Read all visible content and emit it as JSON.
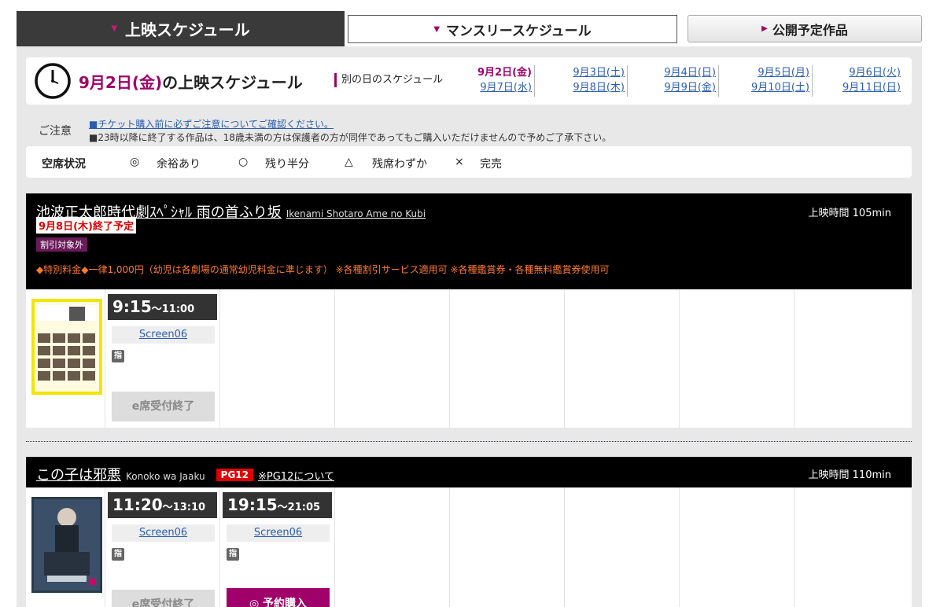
{
  "tabs": {
    "current": "上映スケジュール",
    "monthly": "マンスリースケジュール",
    "upcoming": "公開予定作品"
  },
  "date_header": {
    "date": "9月2日(金)",
    "suffix": "の上映スケジュール",
    "other_days_label": "別の日のスケジュール",
    "days": [
      [
        "9月2日(金)",
        "9月7日(水)"
      ],
      [
        "9月3日(土)",
        "9月8日(木)"
      ],
      [
        "9月4日(日)",
        "9月9日(金)"
      ],
      [
        "9月5日(月)",
        "9月10日(土)"
      ],
      [
        "9月6日(火)",
        "9月11日(日)"
      ]
    ]
  },
  "notice": {
    "label": "ご注意",
    "link": "■チケット購入前に必ずご注意についてご確認ください。",
    "text": "■23時以降に終了する作品は、18歳未満の方は保護者の方が同伴であってもご購入いただけませんので予めご了承下さい。"
  },
  "legend": {
    "title": "空席状況",
    "items": [
      {
        "symbol": "◎",
        "label": "余裕あり"
      },
      {
        "symbol": "○",
        "label": "残り半分"
      },
      {
        "symbol": "△",
        "label": "残席わずか"
      },
      {
        "symbol": "×",
        "label": "完売"
      }
    ]
  },
  "films": [
    {
      "title": "池波正太郎時代劇ｽﾍﾟｼｬﾙ 雨の首ふり坂",
      "romaji": "Ikenami Shotaro Ame no Kubi",
      "runtime": "上映時間 105min",
      "end_notice": "9月8日(木)終了予定",
      "discount": "割引対象外",
      "price_note": "◆特別料金◆一律1,000円（幼児は各劇場の通常幼児料金に準じます） ※各種割引サービス適用可 ※各種鑑賞券・各種無料鑑賞券使用可",
      "showings": [
        {
          "start": "9:15",
          "end": "～11:00",
          "screen": "Screen06",
          "sign": "指",
          "button": "e席受付終了"
        }
      ]
    },
    {
      "title": "この子は邪悪",
      "romaji": "Konoko wa Jaaku",
      "rating": "PG12",
      "rating_link": "※PG12について",
      "runtime": "上映時間 110min",
      "showings": [
        {
          "start": "11:20",
          "end": "～13:10",
          "screen": "Screen06",
          "sign": "指",
          "button": "e席受付終了"
        },
        {
          "start": "19:15",
          "end": "～21:05",
          "screen": "Screen06",
          "sign": "指",
          "button": "◎ 予約購入"
        }
      ]
    }
  ]
}
